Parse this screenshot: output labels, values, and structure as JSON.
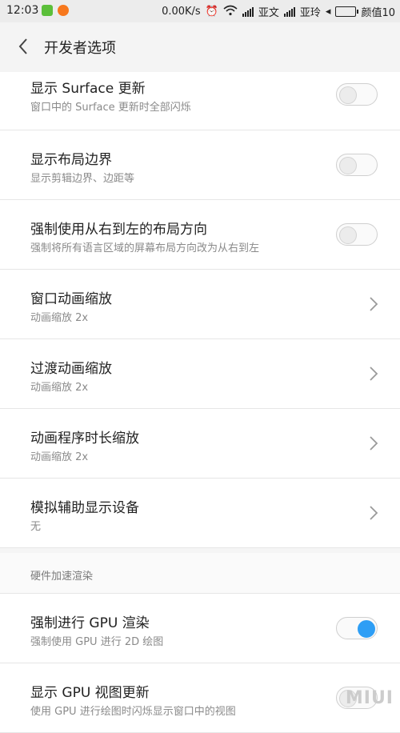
{
  "status": {
    "time": "12:03",
    "speed": "0.00K/s",
    "carrier1": "亚文",
    "carrier2": "亚玲",
    "battery_label": "颜值10"
  },
  "header": {
    "title": "开发者选项"
  },
  "items": [
    {
      "title": "显示 Surface 更新",
      "sub": "窗口中的 Surface 更新时全部闪烁",
      "control": "toggle",
      "on": false
    },
    {
      "title": "显示布局边界",
      "sub": "显示剪辑边界、边距等",
      "control": "toggle",
      "on": false
    },
    {
      "title": "强制使用从右到左的布局方向",
      "sub": "强制将所有语言区域的屏幕布局方向改为从右到左",
      "control": "toggle",
      "on": false
    },
    {
      "title": "窗口动画缩放",
      "sub": "动画缩放 2x",
      "control": "chevron"
    },
    {
      "title": "过渡动画缩放",
      "sub": "动画缩放 2x",
      "control": "chevron"
    },
    {
      "title": "动画程序时长缩放",
      "sub": "动画缩放 2x",
      "control": "chevron"
    },
    {
      "title": "模拟辅助显示设备",
      "sub": "无",
      "control": "chevron"
    }
  ],
  "section": {
    "label": "硬件加速渲染"
  },
  "items2": [
    {
      "title": "强制进行 GPU 渲染",
      "sub": "强制使用 GPU 进行 2D 绘图",
      "control": "toggle",
      "on": true
    },
    {
      "title": "显示 GPU 视图更新",
      "sub": "使用 GPU 进行绘图时闪烁显示窗口中的视图",
      "control": "toggle",
      "on": false
    }
  ],
  "watermark": "MIUI",
  "colors": {
    "accent": "#2e9ef5"
  }
}
